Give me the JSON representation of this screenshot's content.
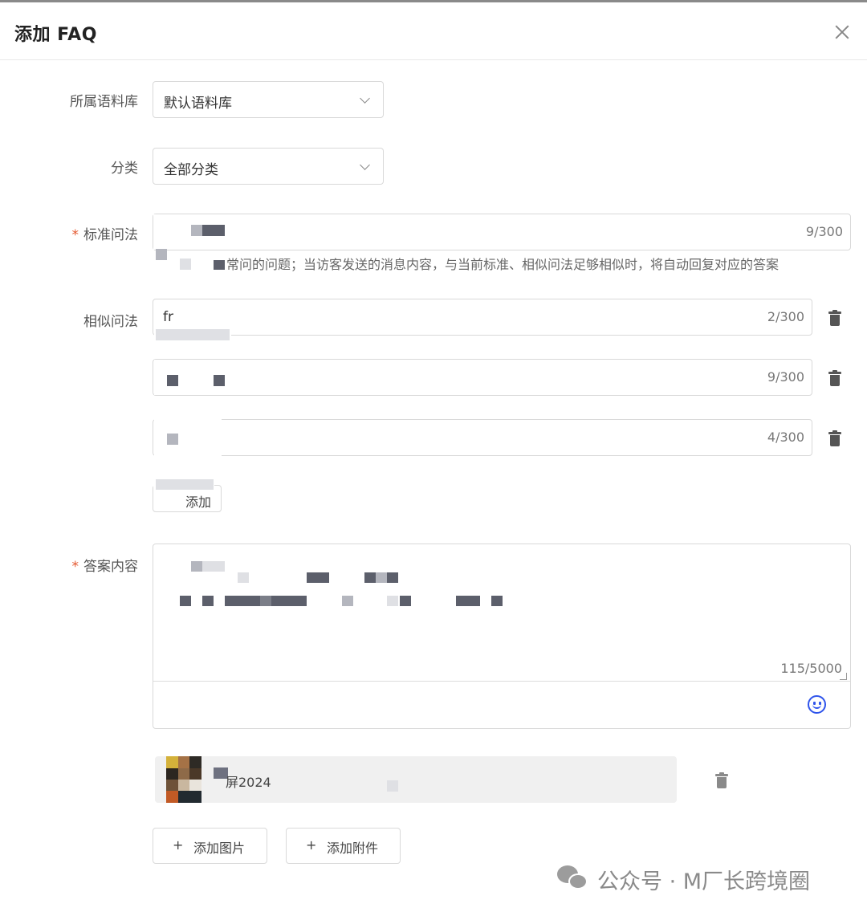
{
  "dialog": {
    "title": "添加 FAQ"
  },
  "form": {
    "corpus": {
      "label": "所属语料库",
      "value": "默认语料库"
    },
    "category": {
      "label": "分类",
      "value": "全部分类"
    },
    "standard_question": {
      "required_mark": "*",
      "label": "标准问法",
      "count": "9/300",
      "hint": "常问的问题；当访客发送的消息内容，与当前标准、相似问法足够相似时，将自动回复对应的答案"
    },
    "similar_questions": {
      "label": "相似问法",
      "items": [
        {
          "value": "fr",
          "count": "2/300"
        },
        {
          "value": "",
          "count": "9/300"
        },
        {
          "value": "",
          "count": "4/300"
        }
      ],
      "add_label": "添加"
    },
    "answer": {
      "required_mark": "*",
      "label": "答案内容",
      "count": "115/5000",
      "attachment_name": "屏2024"
    },
    "buttons": {
      "add_image_label": "添加图片",
      "add_attachment_label": "添加附件",
      "plus": "+"
    }
  },
  "watermark": {
    "text": "公众号 · M厂长跨境圈"
  },
  "colors": {
    "required": "#e4572e",
    "emoji": "#2f54eb",
    "border": "#d9d9d9"
  }
}
